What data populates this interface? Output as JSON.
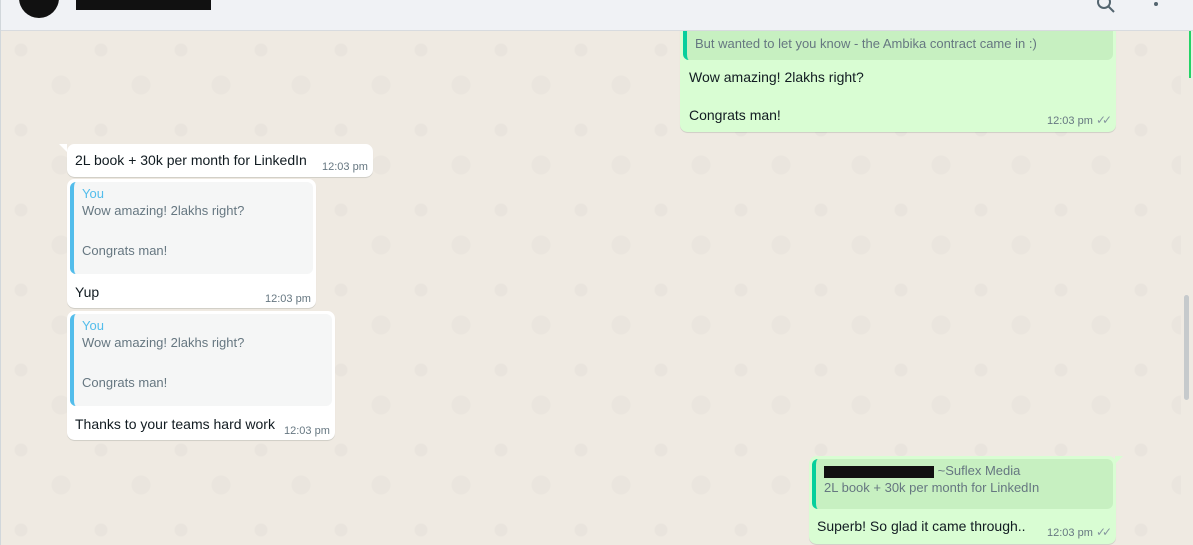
{
  "header": {
    "search_icon": "search-icon",
    "menu_icon": "kebab-menu-icon"
  },
  "messages": {
    "m1": {
      "quote_text": "But wanted to let you know - the Ambika contract came in :)",
      "line1": "Wow amazing! 2lakhs right?",
      "line2": "Congrats man!",
      "time": "12:03 pm",
      "ticks": "✓✓"
    },
    "m2": {
      "text": "2L book + 30k per month for LinkedIn",
      "time": "12:03 pm"
    },
    "m3": {
      "quote_author": "You",
      "quote_text": "Wow amazing! 2lakhs right?\n\nCongrats man!",
      "text": "Yup",
      "time": "12:03 pm"
    },
    "m4": {
      "quote_author": "You",
      "quote_text": "Wow amazing! 2lakhs right?\n\nCongrats man!",
      "text": "Thanks to your teams hard work",
      "time": "12:03 pm"
    },
    "m5": {
      "quote_author_suffix": "~Suflex Media",
      "quote_text": "2L book + 30k per month for LinkedIn",
      "text": "Superb! So glad it came through..",
      "time": "12:03 pm",
      "ticks": "✓✓"
    }
  },
  "colors": {
    "chat_bg": "#efeae2",
    "incoming": "#ffffff",
    "outgoing": "#d9fdd3",
    "accent_in_quote": "#53bdeb",
    "accent_out_quote": "#06cf9c"
  }
}
